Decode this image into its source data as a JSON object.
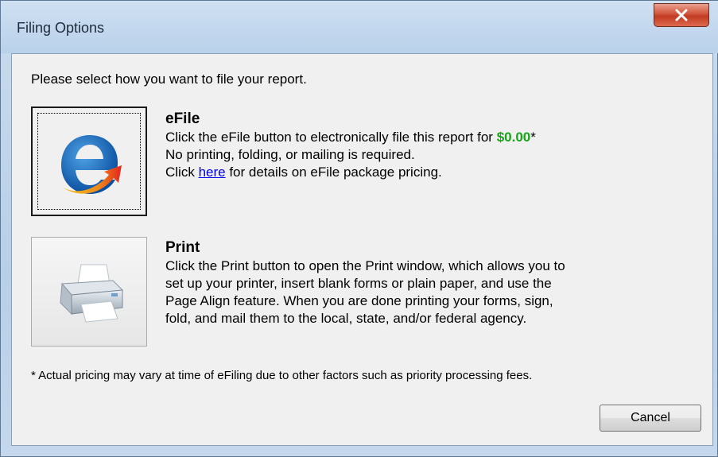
{
  "window": {
    "title": "Filing Options",
    "close_label": "X",
    "colors": {
      "close_red": "#c23b22",
      "titlebar": "#b9d1ea"
    }
  },
  "prompt": "Please select how you want to file your report.",
  "efile": {
    "icon": "efile-icon",
    "heading": "eFile",
    "line1_prefix": "Click the eFile button to electronically file this report for ",
    "price": "$0.00",
    "price_suffix": "*",
    "line2": "No printing, folding, or mailing is required.",
    "line3_prefix": "Click ",
    "link_text": "here",
    "line3_suffix": " for details on eFile package pricing.",
    "price_color": "#17a317"
  },
  "print": {
    "icon": "printer-icon",
    "heading": "Print",
    "line1": "Click the Print button to open the Print window, which allows you to",
    "line2": "set up your printer, insert blank forms or plain paper, and use the",
    "line3": "Page Align feature. When you are done printing your forms, sign,",
    "line4": "fold, and mail them to the local, state, and/or federal agency."
  },
  "footnote": "* Actual pricing may vary at time of eFiling due to other factors such as priority processing fees.",
  "cancel_label": "Cancel"
}
